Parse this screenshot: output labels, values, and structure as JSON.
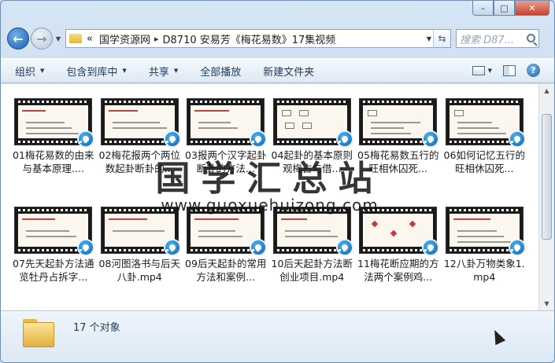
{
  "window": {
    "caption_min": "–",
    "caption_max": "□",
    "caption_close": "✕"
  },
  "nav": {
    "back_glyph": "←",
    "forward_glyph": "→",
    "address": {
      "overflow": "«",
      "parts": [
        "国学资源网",
        "D8710 安易芳《梅花易数》17集视频"
      ],
      "separator": "▸"
    },
    "search_placeholder": "搜索 D87..."
  },
  "toolbar": {
    "organize": "组织",
    "include_in_library": "包含到库中",
    "share": "共享",
    "play_all": "全部播放",
    "new_folder": "新建文件夹",
    "help": "?"
  },
  "files": [
    {
      "name": "01梅花易数的由来与基本原理...."
    },
    {
      "name": "02梅花报两个两位数起卦断卦的..."
    },
    {
      "name": "03报两个汉字起卦断卦的方法..."
    },
    {
      "name": "04起卦的基本原则观梅占与借..."
    },
    {
      "name": "05梅花易数五行的旺相休囚死..."
    },
    {
      "name": "06如何记忆五行的旺相休囚死..."
    },
    {
      "name": "07先天起卦方法通览牡丹占拆字..."
    },
    {
      "name": "08河图洛书与后天八卦.mp4"
    },
    {
      "name": "09后天起卦的常用方法和案例..."
    },
    {
      "name": "10后天起卦方法断创业项目.mp4"
    },
    {
      "name": "11梅花断应期的方法两个案例鸡..."
    },
    {
      "name": "12八卦万物类象1.mp4"
    }
  ],
  "watermark": {
    "chinese": "国学汇总站",
    "url": "www.guoxuehuizong.com"
  },
  "details": {
    "count": "17 个对象"
  }
}
